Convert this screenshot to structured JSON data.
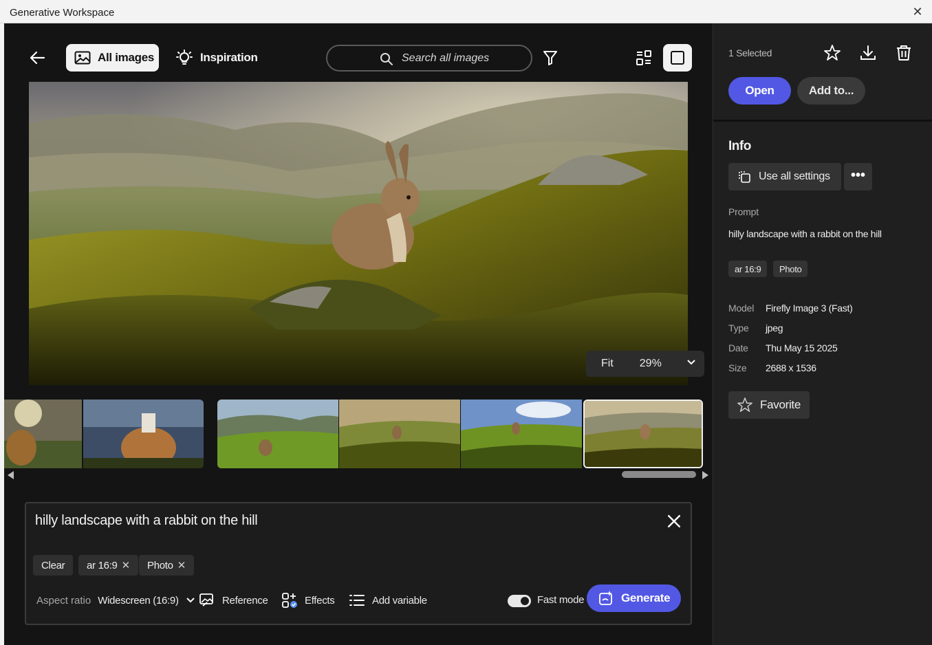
{
  "window": {
    "title": "Generative Workspace",
    "close_glyph": "✕"
  },
  "toolbar": {
    "back_icon": "arrow-left-icon",
    "tab_all_images": "All images",
    "tab_inspiration": "Inspiration",
    "search_placeholder": "Search all images",
    "filter_icon": "filter-icon",
    "grid_view_icon": "grid-view-icon",
    "single_view_icon": "single-view-icon"
  },
  "viewer": {
    "fit_label": "Fit",
    "zoom_level": "29%"
  },
  "thumbnails": {
    "count": 7,
    "selected_index": 6
  },
  "prompt_panel": {
    "prompt_text": "hilly landscape with a rabbit on the hill",
    "clear_label": "Clear",
    "chips": [
      {
        "label": "ar 16:9",
        "remove_glyph": "✕"
      },
      {
        "label": "Photo",
        "remove_glyph": "✕"
      }
    ],
    "aspect_ratio_label": "Aspect ratio",
    "aspect_ratio_value": "Widescreen (16:9)",
    "reference_label": "Reference",
    "effects_label": "Effects",
    "add_variable_label": "Add variable",
    "fast_mode_label": "Fast mode",
    "fast_mode_on": true,
    "generate_label": "Generate"
  },
  "details": {
    "selected_count": "1 Selected",
    "open_label": "Open",
    "add_to_label": "Add to...",
    "info_heading": "Info",
    "use_all_settings_label": "Use all settings",
    "more_glyph": "•••",
    "prompt_label": "Prompt",
    "prompt_value": "hilly landscape with a rabbit on the hill",
    "tags": [
      "ar 16:9",
      "Photo"
    ],
    "meta": [
      {
        "label": "Model",
        "value": "Firefly Image 3 (Fast)"
      },
      {
        "label": "Type",
        "value": "jpeg"
      },
      {
        "label": "Date",
        "value": "Thu May 15 2025"
      },
      {
        "label": "Size",
        "value": "2688 x 1536"
      }
    ],
    "favorite_label": "Favorite"
  },
  "colors": {
    "accent": "#5258e4",
    "panel_bg": "#1f1f1f",
    "main_bg": "#141414"
  }
}
